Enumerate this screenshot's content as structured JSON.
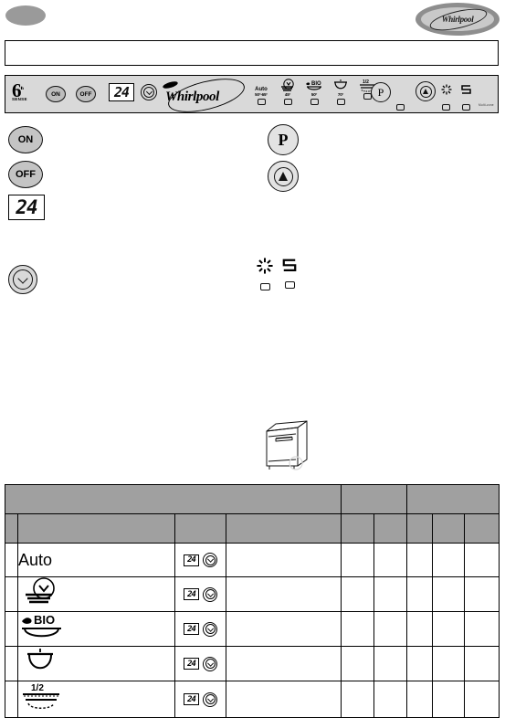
{
  "document": {
    "brand": "Whirlpool",
    "title_band_text": ""
  },
  "corner_marks": {
    "left_oval": "gray-oval-mark",
    "brand_badge_label": "Whirlpool"
  },
  "control_panel": {
    "sixth_sense": {
      "numeral": "6",
      "superscript": "th",
      "word": "SENSE"
    },
    "buttons": [
      {
        "name": "on-button",
        "label": "ON"
      },
      {
        "name": "off-button",
        "label": "OFF"
      }
    ],
    "display": {
      "name": "countdown-display",
      "value": "24"
    },
    "delay_button": {
      "name": "delay-start-button",
      "icon": "clock-chevron-icon"
    },
    "logo": "Whirlpool",
    "programs": [
      {
        "name": "Auto",
        "temperature": "50°-65°",
        "icon": "auto-text-icon"
      },
      {
        "name": "",
        "temperature": "45°",
        "icon": "rapid-plate-icon"
      },
      {
        "name": "BIO",
        "temperature": "50°",
        "icon": "bio-plate-icon"
      },
      {
        "name": "",
        "temperature": "70°",
        "icon": "pot-intensive-icon"
      },
      {
        "name": "1/2",
        "temperature": "",
        "icon": "half-load-plates-icon"
      }
    ],
    "program_button": {
      "name": "program-select-button",
      "label": "P"
    },
    "start_button": {
      "name": "start-button",
      "icon": "start-triangle-icon"
    },
    "indicators": [
      {
        "name": "salt-indicator",
        "icon": "salt-star-icon"
      },
      {
        "name": "rinse-aid-indicator",
        "icon": "rinse-aid-s-icon"
      }
    ],
    "micro_note": "Multi-zone"
  },
  "legend": {
    "items": [
      {
        "name": "legend-on-button",
        "label": "ON",
        "shape": "round-button"
      },
      {
        "name": "legend-off-button",
        "label": "OFF",
        "shape": "round-button"
      },
      {
        "name": "legend-display",
        "label": "24",
        "shape": "lcd"
      },
      {
        "name": "legend-delay-button",
        "label": "",
        "shape": "clock-button"
      },
      {
        "name": "legend-program-button",
        "label": "P",
        "shape": "round-button"
      },
      {
        "name": "legend-start-button",
        "label": "",
        "shape": "start-button"
      },
      {
        "name": "legend-salt-indicator",
        "label": "",
        "shape": "salt-star"
      },
      {
        "name": "legend-rinse-indicator",
        "label": "",
        "shape": "rinse-s"
      },
      {
        "name": "legend-appliance",
        "label": "",
        "shape": "dishwasher-drawing"
      }
    ]
  },
  "program_table": {
    "header_groups": [
      "",
      "",
      "",
      "",
      ""
    ],
    "subheaders": [
      "",
      "",
      "",
      "",
      "",
      "",
      "",
      ""
    ],
    "rows": [
      {
        "program_label": "Auto",
        "program_icon": "auto-text-icon",
        "options": {
          "display": "24",
          "clock": "delay-clock-icon"
        },
        "description": "",
        "c1": "",
        "c2": "",
        "c3": "",
        "c4": "",
        "c5": ""
      },
      {
        "program_label": "",
        "program_icon": "rapid-plate-icon",
        "options": {
          "display": "24",
          "clock": "delay-clock-icon"
        },
        "description": "",
        "c1": "",
        "c2": "",
        "c3": "",
        "c4": "",
        "c5": ""
      },
      {
        "program_label": "BIO",
        "program_icon": "bio-plate-icon",
        "options": {
          "display": "24",
          "clock": "delay-clock-icon"
        },
        "description": "",
        "c1": "",
        "c2": "",
        "c3": "",
        "c4": "",
        "c5": ""
      },
      {
        "program_label": "",
        "program_icon": "pot-intensive-icon",
        "options": {
          "display": "24",
          "clock": "delay-clock-icon"
        },
        "description": "",
        "c1": "",
        "c2": "",
        "c3": "",
        "c4": "",
        "c5": ""
      },
      {
        "program_label": "1/2",
        "program_icon": "half-load-plates-icon",
        "options": {
          "display": "24",
          "clock": "delay-clock-icon"
        },
        "description": "",
        "c1": "",
        "c2": "",
        "c3": "",
        "c4": "",
        "c5": ""
      }
    ]
  },
  "colors": {
    "panel_bg": "#d9d9d9",
    "table_header_bg": "#a0a0a0",
    "button_gray": "#bdbdbd",
    "mark_gray": "#9a9a9a",
    "line": "#000000"
  }
}
